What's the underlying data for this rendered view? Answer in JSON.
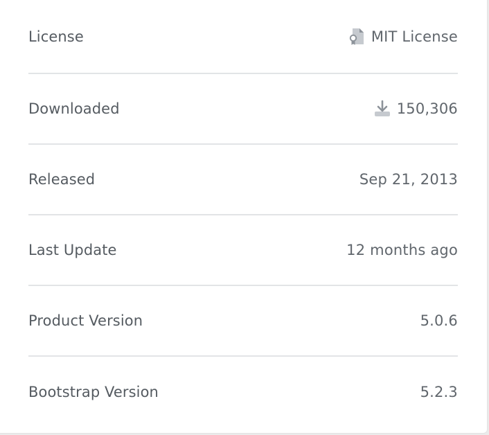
{
  "details": {
    "rows": [
      {
        "label": "License",
        "value": "MIT License",
        "icon": "license-certificate-icon"
      },
      {
        "label": "Downloaded",
        "value": "150,306",
        "icon": "download-icon"
      },
      {
        "label": "Released",
        "value": "Sep 21, 2013"
      },
      {
        "label": "Last Update",
        "value": "12 months ago"
      },
      {
        "label": "Product Version",
        "value": "5.0.6"
      },
      {
        "label": "Bootstrap Version",
        "value": "5.2.3"
      }
    ]
  },
  "colors": {
    "label": "#555b61",
    "value": "#60666c",
    "divider": "#e2e4e6",
    "icon": "#8d939a",
    "icon_light": "#c6cacf"
  }
}
